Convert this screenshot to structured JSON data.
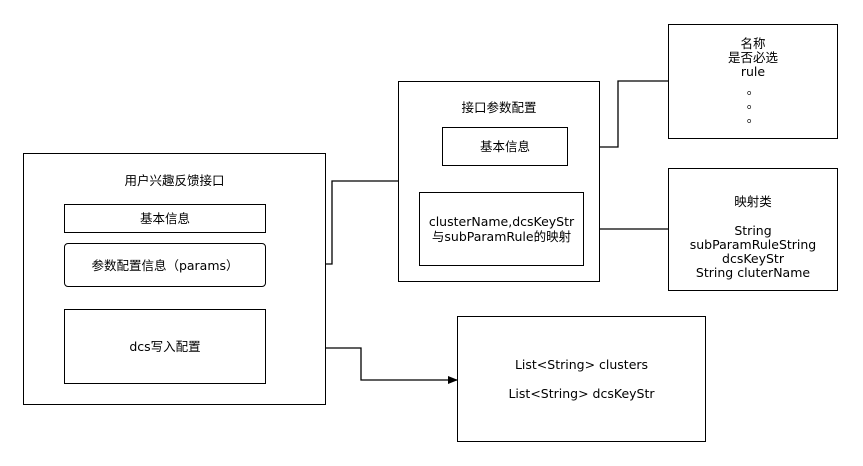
{
  "main_box": {
    "title": "用户兴趣反馈接口",
    "basic_info": "基本信息",
    "params_info": "参数配置信息（params）",
    "dcs_write": "dcs写入配置"
  },
  "interface_box": {
    "title": "接口参数配置",
    "basic_info": "基本信息",
    "mapping": [
      "clusterName,dcsKeyStr",
      "与subParamRule的映射"
    ]
  },
  "rule_box": {
    "lines": [
      "名称",
      "是否必选",
      "rule",
      "。",
      "。",
      "。"
    ]
  },
  "mapping_class_box": {
    "title": "映射类",
    "fields": [
      "String",
      "subParamRuleString",
      "dcsKeyStr",
      "String cluterName"
    ]
  },
  "list_box": {
    "lines": [
      "List<String> clusters",
      "List<String> dcsKeyStr"
    ]
  }
}
